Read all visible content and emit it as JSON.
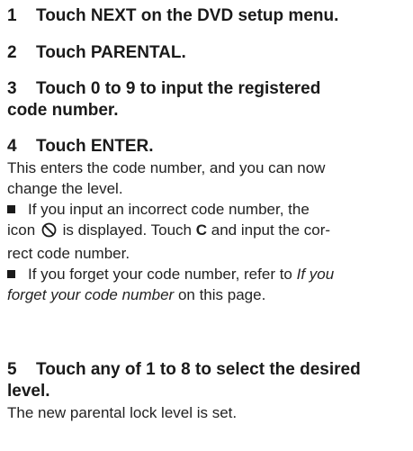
{
  "steps": [
    {
      "num": "1",
      "title": "Touch NEXT on the DVD setup menu."
    },
    {
      "num": "2",
      "title": "Touch PARENTAL."
    },
    {
      "num": "3",
      "title_line1": "Touch 0 to 9 to input the registered",
      "title_line2": "code number."
    },
    {
      "num": "4",
      "title": "Touch ENTER.",
      "body_line1": "This enters the code number, and you can now",
      "body_line2": "change the level.",
      "bullet1": {
        "line1": "If you input an incorrect code number, the",
        "line2_a": "icon",
        "line2_b": "is displayed. Touch",
        "key": "C",
        "line2_c": "and input the cor-",
        "line3": "rect code number."
      },
      "bullet2": {
        "line1_a": "If you forget your code number, refer to",
        "line1_italic": "If you",
        "line2_italic": "forget your code number",
        "line2_b": "on this page."
      }
    },
    {
      "num": "5",
      "title_line1": "Touch any of 1 to 8 to select the desired",
      "title_line2": "level.",
      "body": "The new parental lock level is set."
    }
  ],
  "icons": {
    "prohibit": "prohibit-icon",
    "bullet": "square-bullet"
  }
}
